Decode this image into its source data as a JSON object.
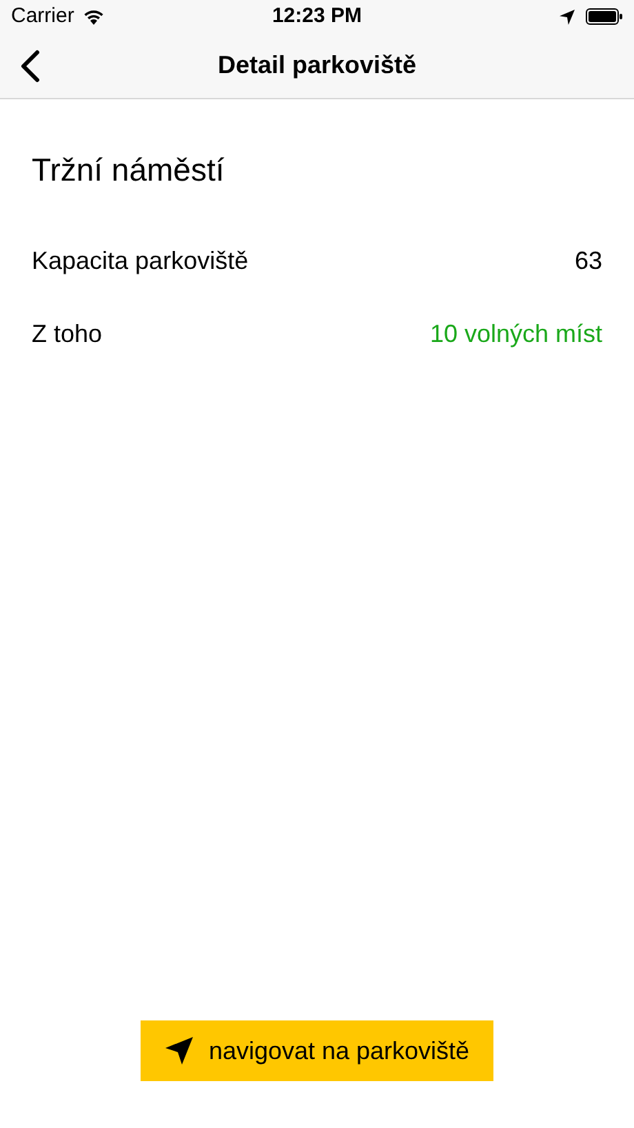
{
  "status_bar": {
    "carrier": "Carrier",
    "time": "12:23 PM"
  },
  "nav_bar": {
    "title": "Detail parkoviště"
  },
  "parking": {
    "name": "Tržní náměstí",
    "rows": [
      {
        "label": "Kapacita parkoviště",
        "value": "63",
        "color": "#000000"
      },
      {
        "label": "Z toho",
        "value": "10 volných míst",
        "color": "#1aa81a"
      }
    ]
  },
  "navigate_button": {
    "label": "navigovat na parkoviště"
  }
}
